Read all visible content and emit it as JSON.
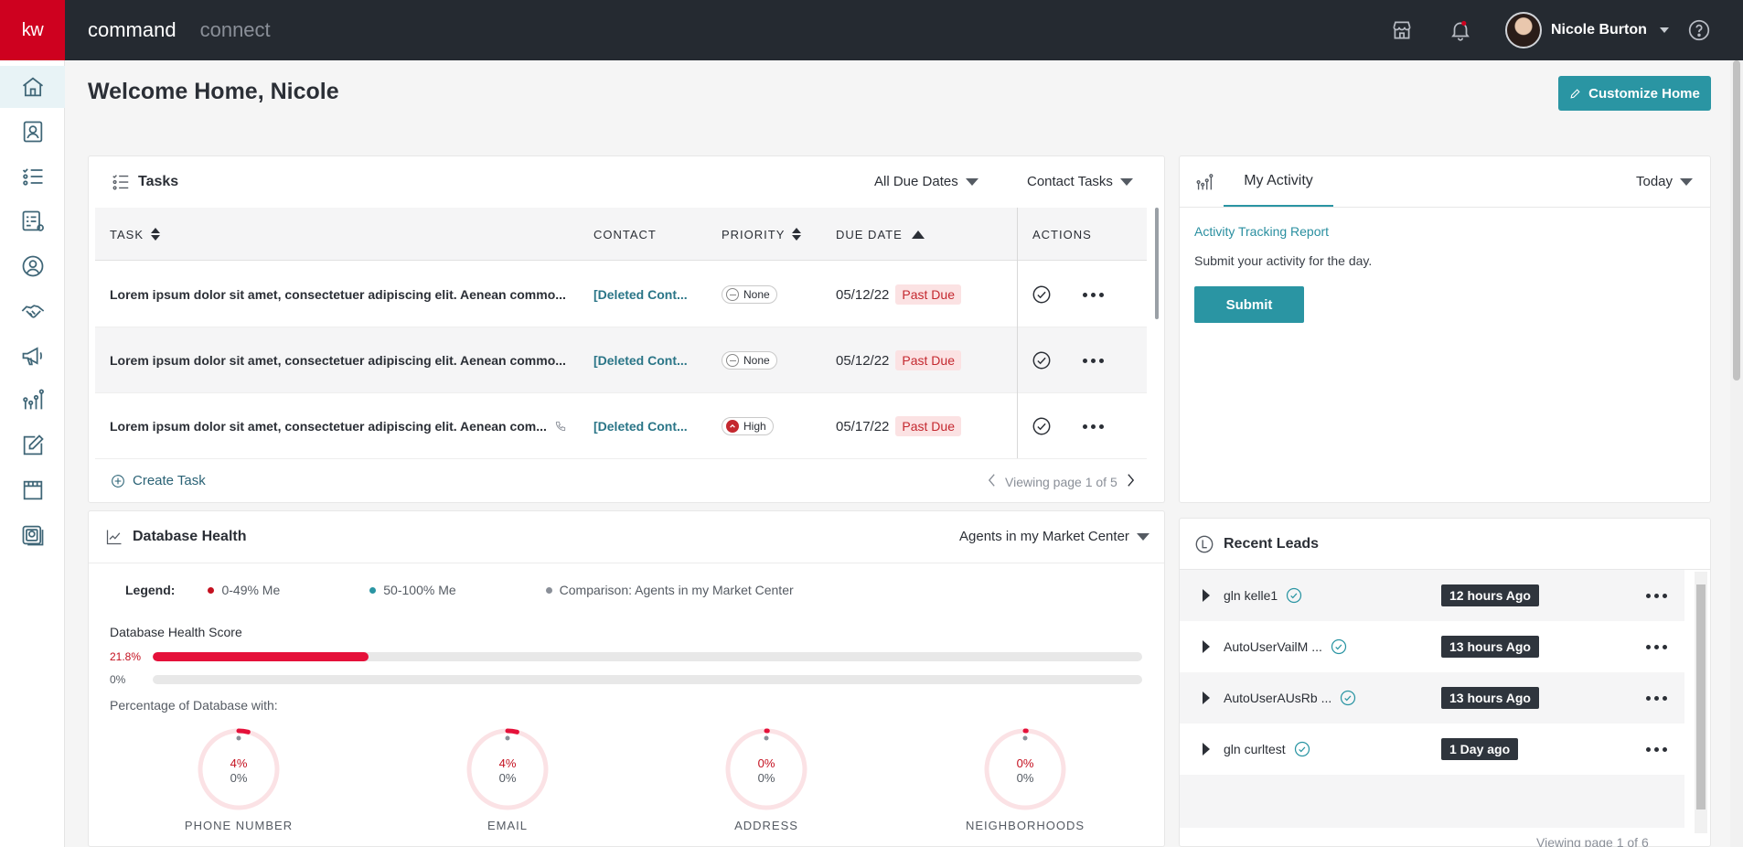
{
  "topbar": {
    "logo": "kw",
    "brand_primary": "command",
    "brand_secondary": "connect",
    "user_name": "Nicole Burton",
    "icons": [
      "storefront-icon",
      "bell-icon",
      "help-icon"
    ]
  },
  "sidebar": {
    "items": [
      {
        "name": "home",
        "icon": "home-icon"
      },
      {
        "name": "contacts",
        "icon": "contact-card-icon"
      },
      {
        "name": "tasks",
        "icon": "checklist-icon"
      },
      {
        "name": "smartplans",
        "icon": "plan-settings-icon"
      },
      {
        "name": "people",
        "icon": "person-circle-icon"
      },
      {
        "name": "opportunities",
        "icon": "handshake-icon"
      },
      {
        "name": "marketing",
        "icon": "megaphone-icon"
      },
      {
        "name": "insights",
        "icon": "chart-icon"
      },
      {
        "name": "notes",
        "icon": "edit-icon"
      },
      {
        "name": "marketplace",
        "icon": "store-icon"
      },
      {
        "name": "photos",
        "icon": "gallery-icon"
      }
    ]
  },
  "page": {
    "title": "Welcome Home, Nicole",
    "customize_label": "Customize Home"
  },
  "tasks": {
    "title": "Tasks",
    "filter_dates": "All Due Dates",
    "filter_type": "Contact Tasks",
    "columns": [
      "TASK",
      "CONTACT",
      "PRIORITY",
      "DUE DATE",
      "ACTIONS"
    ],
    "rows": [
      {
        "task": "Lorem ipsum dolor sit amet, consectetuer adipiscing elit. Aenean commo...",
        "contact": "[Deleted Cont...",
        "priority": "None",
        "due": "05/12/22",
        "status": "Past Due",
        "phone": false
      },
      {
        "task": "Lorem ipsum dolor sit amet, consectetuer adipiscing elit. Aenean commo...",
        "contact": "[Deleted Cont...",
        "priority": "None",
        "due": "05/12/22",
        "status": "Past Due",
        "phone": false
      },
      {
        "task": "Lorem ipsum dolor sit amet, consectetuer adipiscing elit. Aenean com...",
        "contact": "[Deleted Cont...",
        "priority": "High",
        "due": "05/17/22",
        "status": "Past Due",
        "phone": true
      }
    ],
    "create_label": "Create Task",
    "pager": "Viewing page 1 of 5"
  },
  "activity": {
    "tab": "My Activity",
    "period": "Today",
    "report_link": "Activity Tracking Report",
    "note": "Submit your activity for the day.",
    "submit_label": "Submit"
  },
  "database_health": {
    "title": "Database Health",
    "filter": "Agents in my Market Center",
    "legend_label": "Legend:",
    "legend": [
      {
        "label": "0-49% Me",
        "color": "#c4101f"
      },
      {
        "label": "50-100% Me",
        "color": "#2a95a3"
      },
      {
        "label": "Comparison: Agents in my Market Center",
        "color": "#8a8f98"
      }
    ],
    "score_title": "Database Health Score",
    "score_me": "21.8%",
    "score_me_value": 0.218,
    "score_compare": "0%",
    "score_compare_value": 0,
    "pct_title": "Percentage of Database with:",
    "rings": [
      {
        "label": "PHONE NUMBER",
        "me": "4%",
        "compare": "0%",
        "me_value": 0.04
      },
      {
        "label": "EMAIL",
        "me": "4%",
        "compare": "0%",
        "me_value": 0.04
      },
      {
        "label": "ADDRESS",
        "me": "0%",
        "compare": "0%",
        "me_value": 0
      },
      {
        "label": "NEIGHBORHOODS",
        "me": "0%",
        "compare": "0%",
        "me_value": 0
      }
    ]
  },
  "recent_leads": {
    "title": "Recent Leads",
    "rows": [
      {
        "name": "gln kelle1",
        "time": "12 hours Ago"
      },
      {
        "name": "AutoUserVailM ...",
        "time": "13 hours Ago"
      },
      {
        "name": "AutoUserAUsRb ...",
        "time": "13 hours Ago"
      },
      {
        "name": "gln curltest",
        "time": "1 Day ago"
      }
    ],
    "pager": "Viewing page 1 of 6"
  }
}
